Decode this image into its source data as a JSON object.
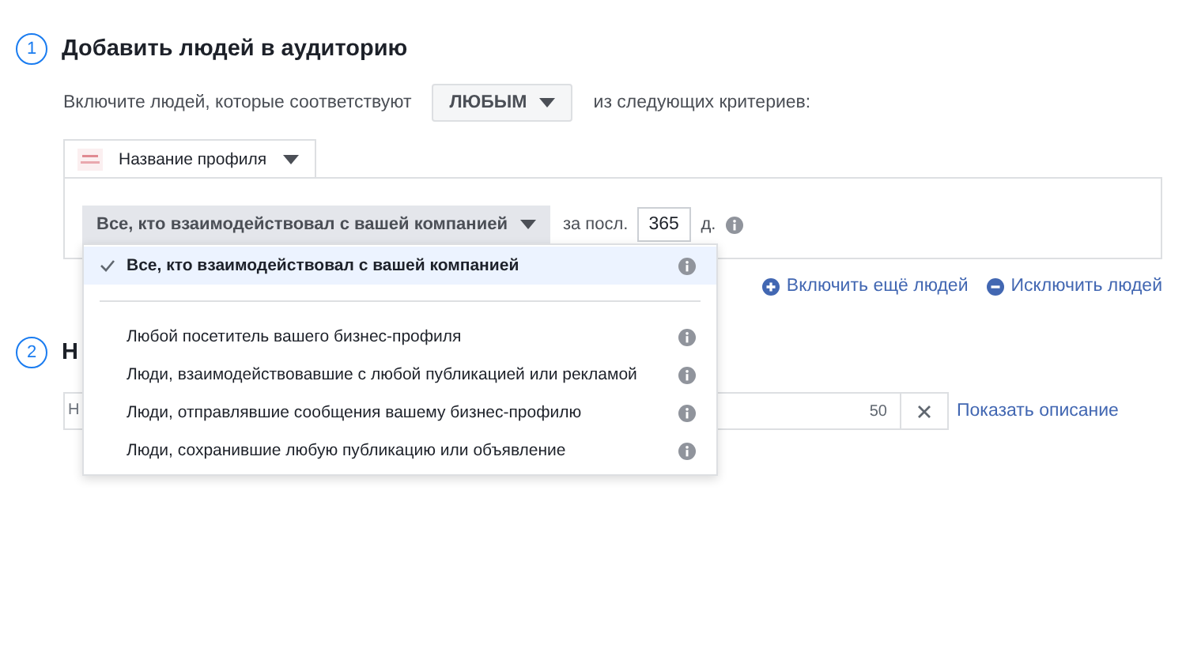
{
  "sections": [
    {
      "number": "1",
      "title": "Добавить людей в аудиторию"
    },
    {
      "number": "2",
      "title": "Н"
    }
  ],
  "match_row": {
    "prefix": "Включите людей, которые соответствуют",
    "choice": "ЛЮБЫМ",
    "suffix": "из следующих критериев:"
  },
  "profile_tab": {
    "label": "Название профиля"
  },
  "rule": {
    "selector": "Все, кто взаимодействовал с вашей компанией",
    "period_label": "за посл.",
    "days": "365",
    "unit": "д."
  },
  "links": [
    {
      "label": "Включить ещё людей",
      "kind": "add"
    },
    {
      "label": "Исключить людей",
      "kind": "remove"
    }
  ],
  "name_field": {
    "placeholder": "Н",
    "counter": "50",
    "link": "Показать описание"
  },
  "menu": {
    "items": [
      {
        "label": "Все, кто взаимодействовал с вашей компанией",
        "selected": true
      },
      {
        "label": "Любой посетитель вашего бизнес-профиля",
        "selected": false
      },
      {
        "label": "Люди, взаимодействовавшие с любой публикацией или рекламой",
        "selected": false
      },
      {
        "label": "Люди, отправлявшие сообщения вашему бизнес-профилю",
        "selected": false
      },
      {
        "label": "Люди, сохранившие любую публикацию или объявление",
        "selected": false
      }
    ]
  }
}
